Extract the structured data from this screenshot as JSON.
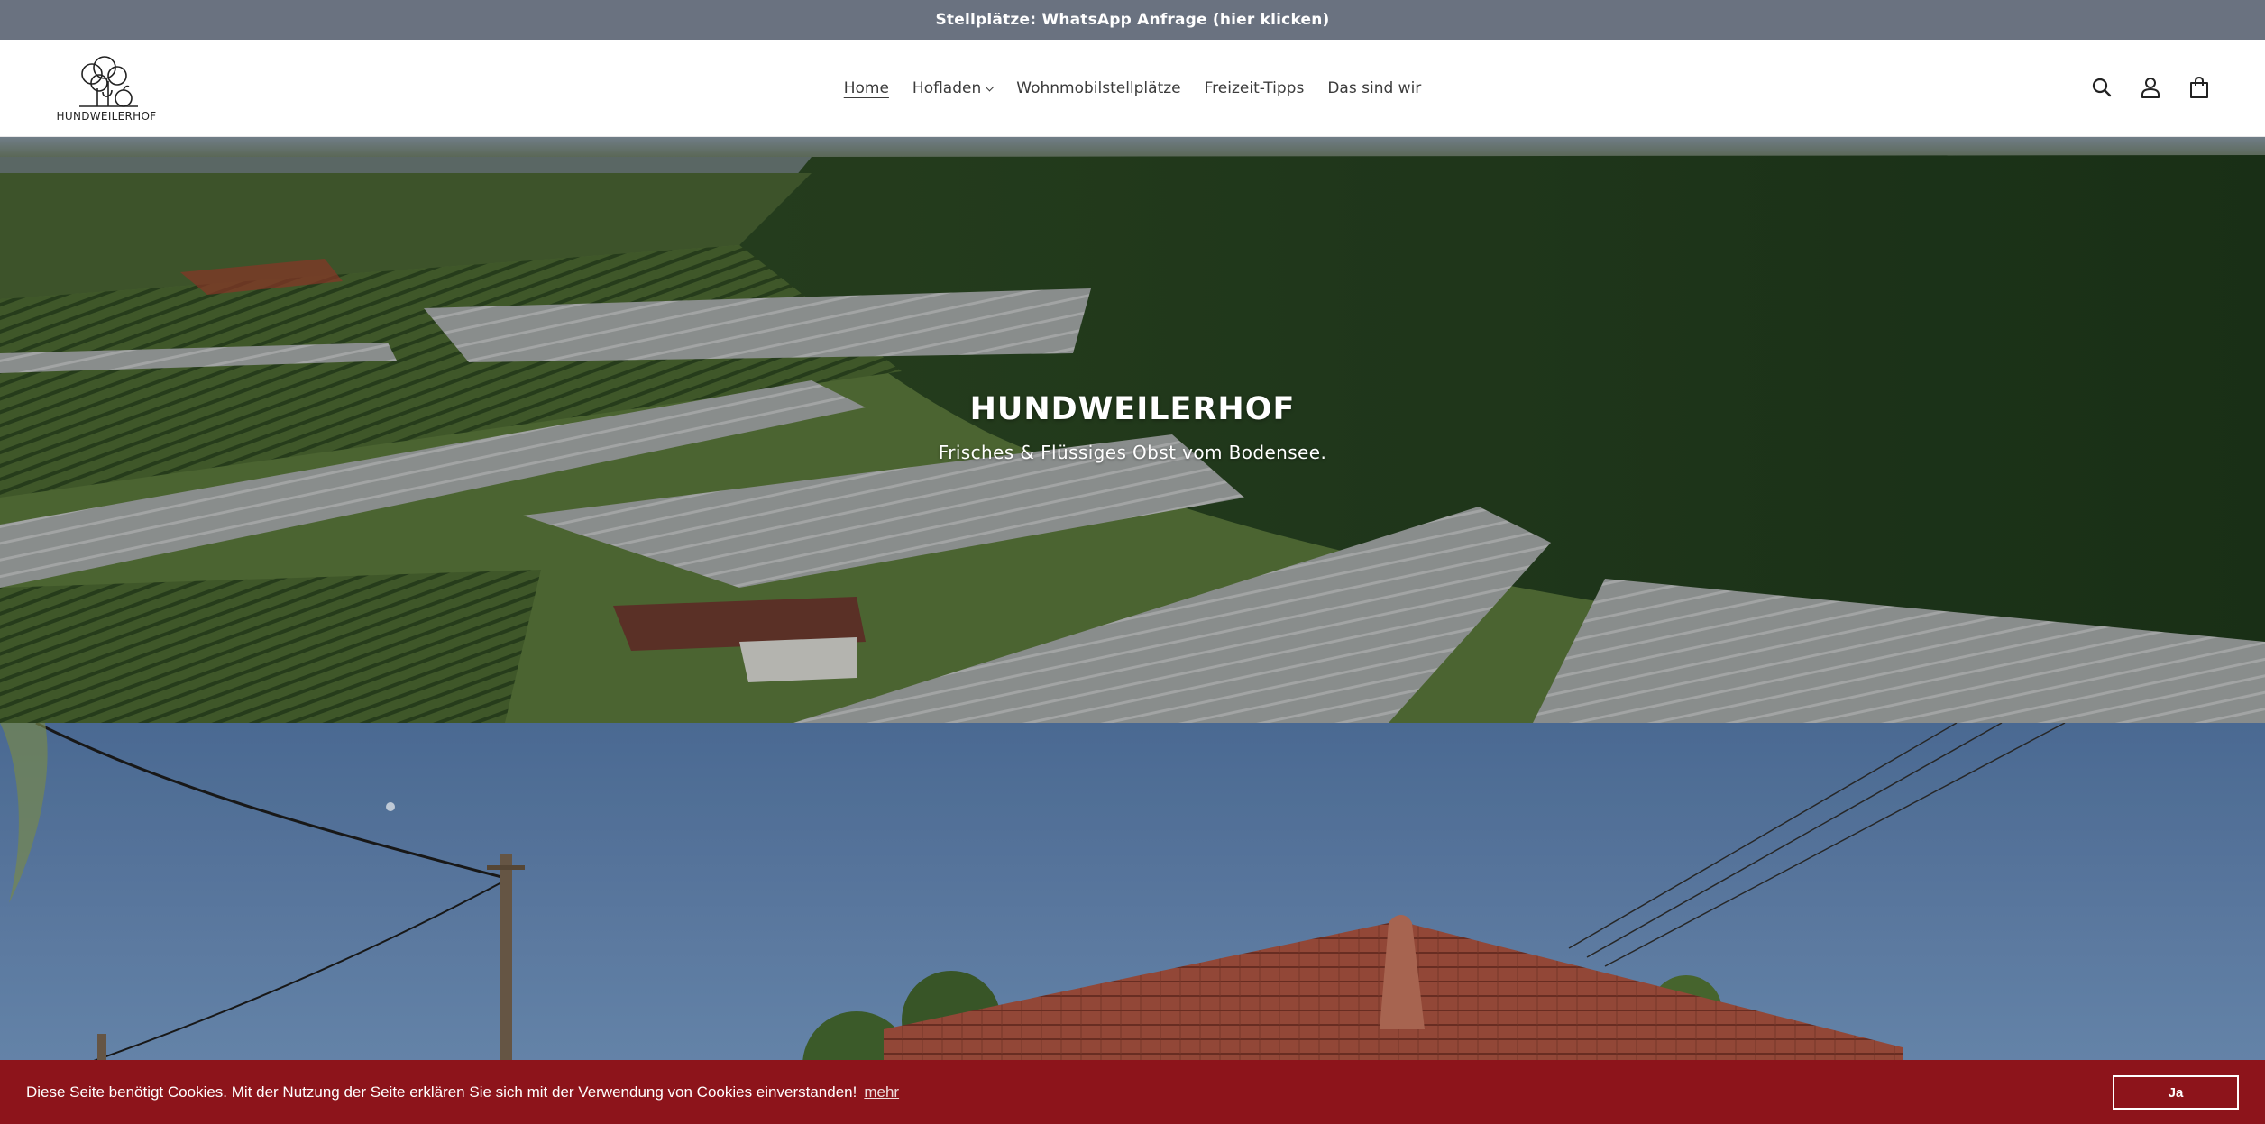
{
  "announcement": {
    "text": "Stellplätze: WhatsApp Anfrage (hier klicken)"
  },
  "header": {
    "logo_text": "HUNDWEILERHOF",
    "nav": [
      {
        "label": "Home",
        "active": true
      },
      {
        "label": "Hofladen",
        "has_dropdown": true
      },
      {
        "label": "Wohnmobilstellplätze"
      },
      {
        "label": "Freizeit-Tipps"
      },
      {
        "label": "Das sind wir"
      }
    ],
    "icons": [
      "search-icon",
      "account-icon",
      "cart-icon"
    ]
  },
  "hero": {
    "title": "HUNDWEILERHOF",
    "subtitle": "Frisches & Flüssiges Obst vom Bodensee."
  },
  "cookie": {
    "text": "Diese Seite benötigt Cookies. Mit der Nutzung der Seite erklären Sie sich mit der Verwendung von Cookies einverstanden!",
    "more_label": "mehr",
    "accept_label": "Ja"
  },
  "colors": {
    "announcement_bg": "#6a7280",
    "cookie_bg": "#8d141b",
    "header_bg": "#ffffff"
  }
}
